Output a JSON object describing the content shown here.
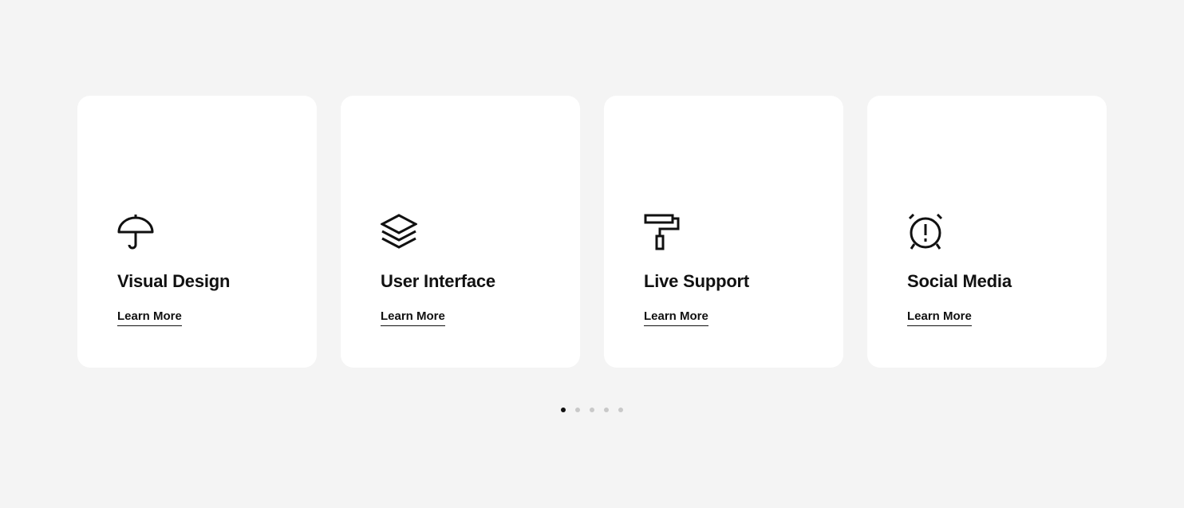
{
  "services": [
    {
      "title": "Visual Design",
      "link_label": "Learn More",
      "icon": "umbrella-icon"
    },
    {
      "title": "User Interface",
      "link_label": "Learn More",
      "icon": "layers-icon"
    },
    {
      "title": "Live Support",
      "link_label": "Learn More",
      "icon": "paint-roller-icon"
    },
    {
      "title": "Social Media",
      "link_label": "Learn More",
      "icon": "alarm-clock-icon"
    }
  ],
  "pagination": {
    "total_pages": 5,
    "active_index": 0
  },
  "colors": {
    "background": "#f4f4f4",
    "card": "#ffffff",
    "text": "#111111",
    "dot_inactive": "#c9c9c9",
    "dot_active": "#111111"
  }
}
